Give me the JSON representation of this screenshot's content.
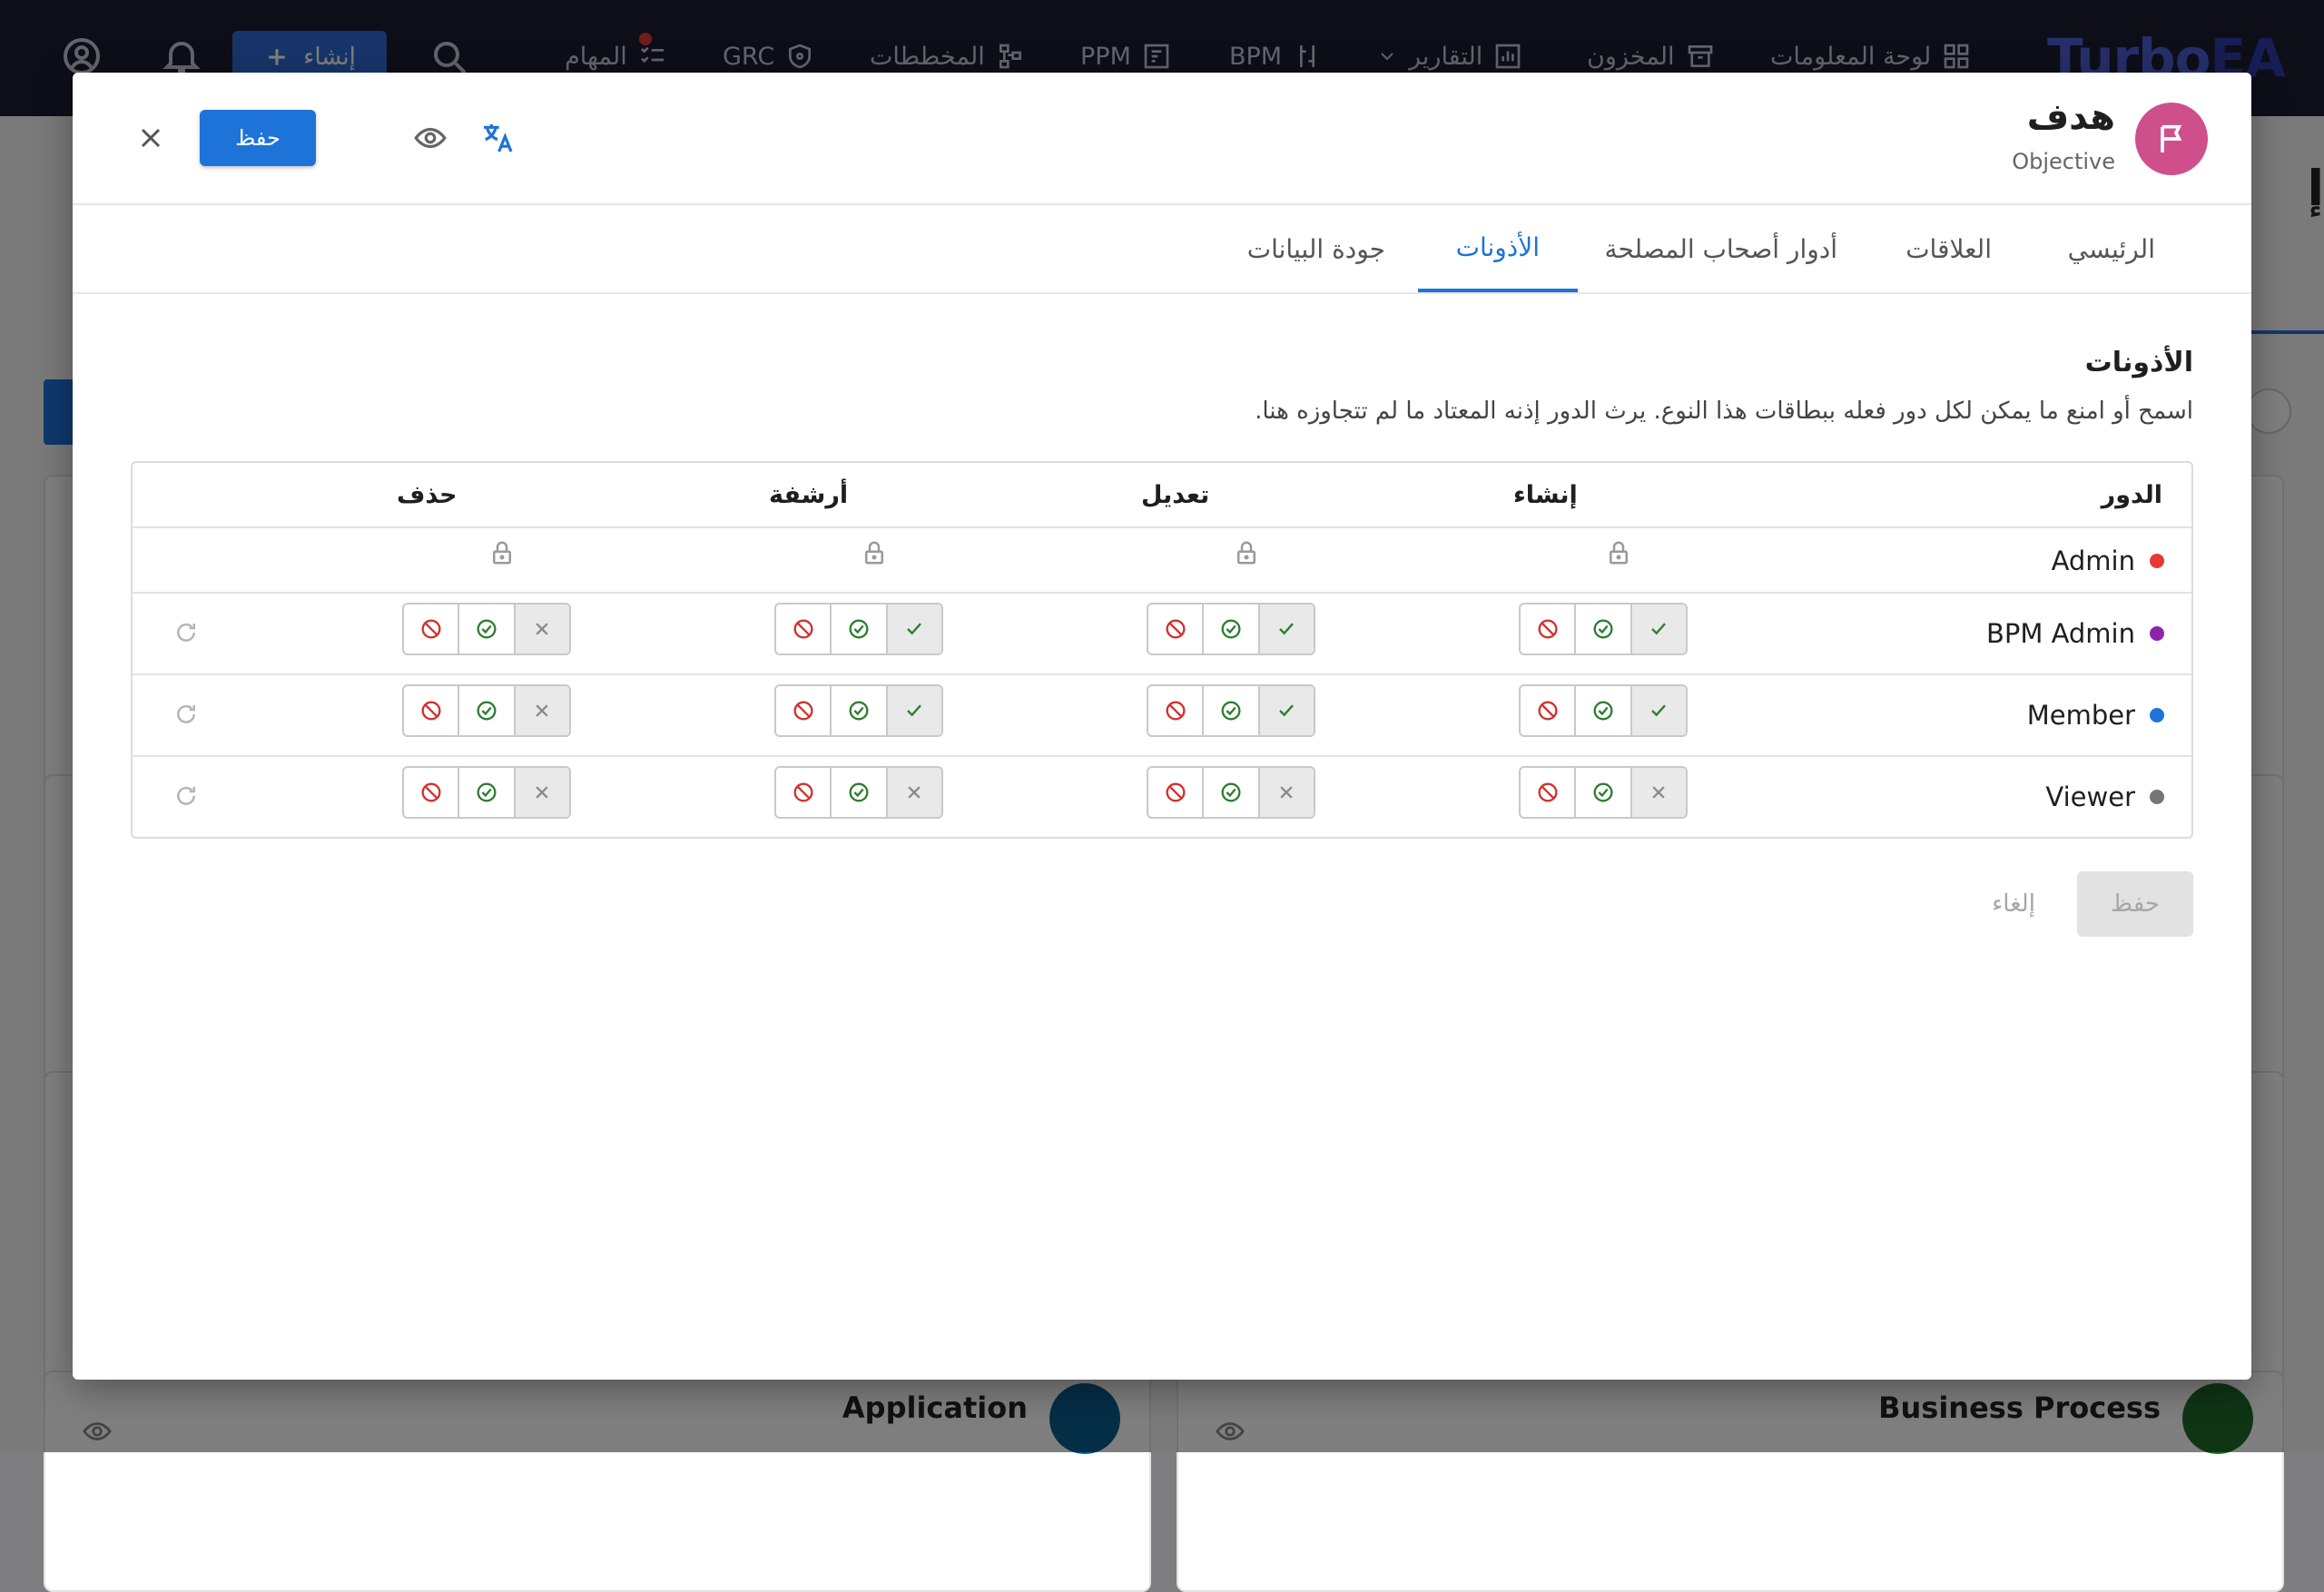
{
  "app": {
    "brand_part1": "Turbo",
    "brand_part2": "EA",
    "nav": [
      {
        "label": "لوحة المعلومات",
        "icon": "dashboard-icon"
      },
      {
        "label": "المخزون",
        "icon": "inventory-icon"
      },
      {
        "label": "التقارير",
        "icon": "reports-icon"
      },
      {
        "label": "BPM",
        "icon": "bpm-icon"
      },
      {
        "label": "PPM",
        "icon": "ppm-icon"
      },
      {
        "label": "المخططات",
        "icon": "diagrams-icon"
      },
      {
        "label": "GRC",
        "icon": "grc-icon"
      },
      {
        "label": "المهام",
        "icon": "tasks-icon"
      }
    ],
    "create_label": "إنشاء",
    "bg_cards": [
      "Application",
      "Business Process"
    ],
    "bg_heading_fragment": "إ"
  },
  "modal": {
    "title": "هدف",
    "subtitle": "Objective",
    "save_label": "حفظ",
    "tabs": [
      {
        "label": "الرئيسي",
        "active": false
      },
      {
        "label": "العلاقات",
        "active": false
      },
      {
        "label": "أدوار أصحاب المصلحة",
        "active": false
      },
      {
        "label": "الأذونات",
        "active": true
      },
      {
        "label": "جودة البيانات",
        "active": false
      }
    ],
    "section_title": "الأذونات",
    "section_description": "اسمح أو امنع ما يمكن لكل دور فعله ببطاقات هذا النوع. يرث الدور إذنه المعتاد ما لم تتجاوزه هنا.",
    "columns": [
      "الدور",
      "إنشاء",
      "تعديل",
      "أرشفة",
      "حذف"
    ],
    "roles": [
      {
        "name": "Admin",
        "color": "#e53935",
        "locked": true
      },
      {
        "name": "BPM Admin",
        "color": "#8e24aa",
        "locked": false,
        "perms": [
          "default-allow",
          "default-allow",
          "default-allow",
          "default-deny"
        ]
      },
      {
        "name": "Member",
        "color": "#1e73d8",
        "locked": false,
        "perms": [
          "default-allow",
          "default-allow",
          "default-allow",
          "default-deny"
        ]
      },
      {
        "name": "Viewer",
        "color": "#757575",
        "locked": false,
        "perms": [
          "default-deny",
          "default-deny",
          "default-deny",
          "default-deny"
        ]
      }
    ],
    "footer_save": "حفظ",
    "footer_cancel": "إلغاء"
  },
  "colors": {
    "accent": "#1e73d8",
    "deny": "#d32f2f",
    "allow": "#2e7d32",
    "avatar": "#cf4f8c"
  }
}
